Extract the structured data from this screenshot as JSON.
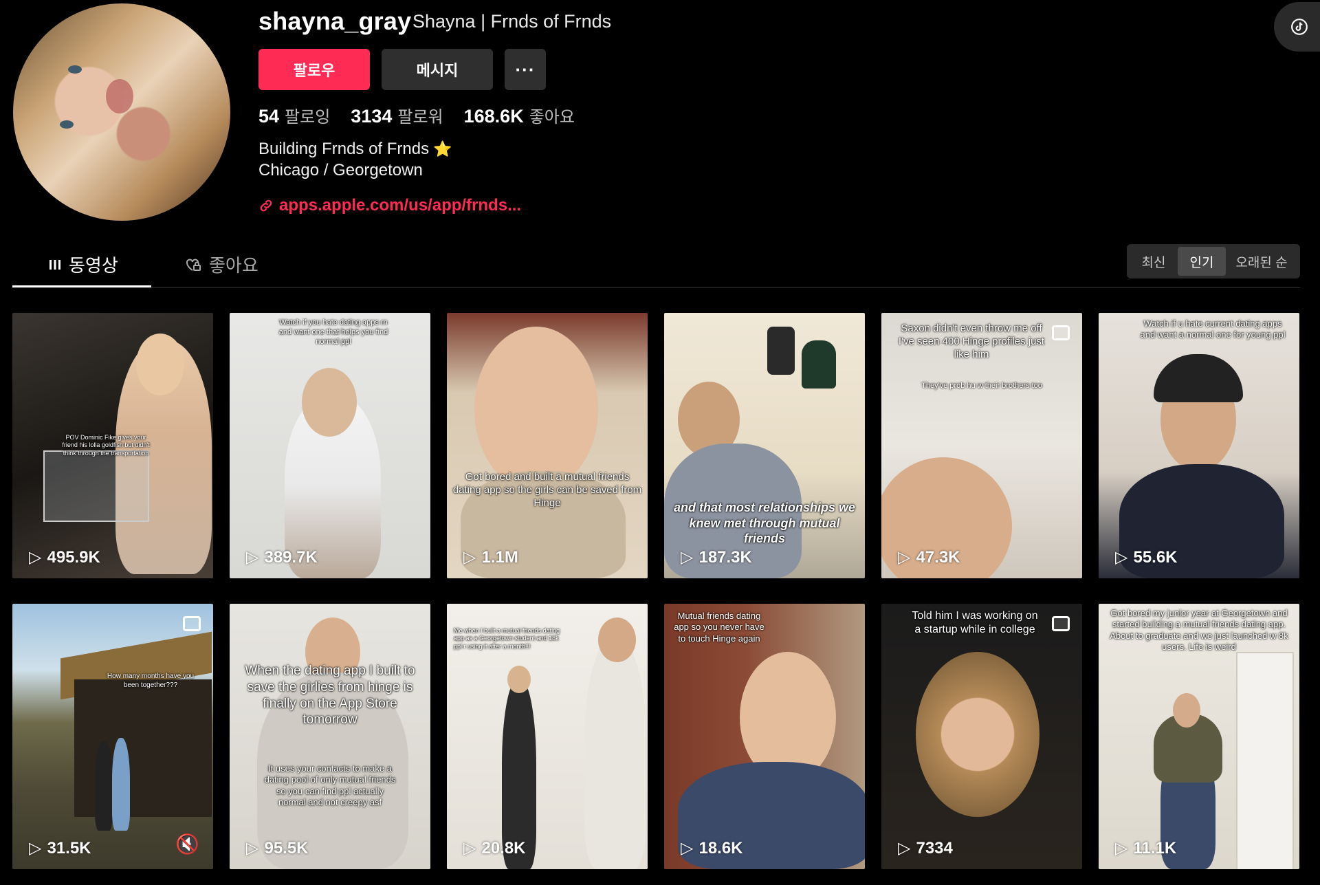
{
  "profile": {
    "username": "shayna_gray",
    "display_name": "Shayna | Frnds of Frnds",
    "follow_label": "팔로우",
    "message_label": "메시지",
    "more_label": "···",
    "stats": [
      {
        "value": "54",
        "label": "팔로잉"
      },
      {
        "value": "3134",
        "label": "팔로워"
      },
      {
        "value": "168.6K",
        "label": "좋아요"
      }
    ],
    "bio_line1": "Building Frnds of Frnds",
    "bio_emoji": "⭐",
    "bio_line2": "Chicago / Georgetown",
    "link": "apps.apple.com/us/app/frnds..."
  },
  "tabs": {
    "videos": "동영상",
    "likes": "좋아요"
  },
  "sort": {
    "options": [
      "최신",
      "인기",
      "오래된 순"
    ],
    "selected": "인기"
  },
  "colors": {
    "accent": "#fe2c55",
    "background": "#000000"
  },
  "videos": [
    {
      "views": "495.9K",
      "caption": "POV Dominic Fike gives your friend his lolla goldfish but didn't think through the transportation"
    },
    {
      "views": "389.7K",
      "caption": "Watch if you hate dating apps rn and want one that helps you find normal ppl"
    },
    {
      "views": "1.1M",
      "caption": "Got bored and built a mutual friends dating app so the girls can be saved from Hinge"
    },
    {
      "views": "187.3K",
      "caption": "and that most relationships we knew met through mutual friends"
    },
    {
      "views": "47.3K",
      "caption": "Saxon didn't even throw me off I've seen 400 Hinge profiles just like him",
      "caption2": "They've prob hu w their brothers too"
    },
    {
      "views": "55.6K",
      "caption": "Watch if u hate current dating apps and want a normal one for young ppl"
    },
    {
      "views": "31.5K",
      "caption": "How many months have you been together???"
    },
    {
      "views": "95.5K",
      "caption": "When the dating app I built to save the girlies from hinge is finally on the App Store tomorrow",
      "caption2": "It uses your contacts to make a dating pool of only mutual friends so you can find ppl actually normal and not creepy asf"
    },
    {
      "views": "20.8K",
      "caption": "Me when I built a mutual friends dating app as a Georgetown student and 18k ppl r using it after a month!!!"
    },
    {
      "views": "18.6K",
      "caption": "Mutual friends dating app so you never have to touch Hinge again"
    },
    {
      "views": "7334",
      "caption": "Told him I was working on a startup while in college"
    },
    {
      "views": "11.1K",
      "caption": "Got bored my junior year at Georgetown and started building a mutual friends dating app. About to graduate and we just launched w 8k users. Life is weird"
    }
  ]
}
